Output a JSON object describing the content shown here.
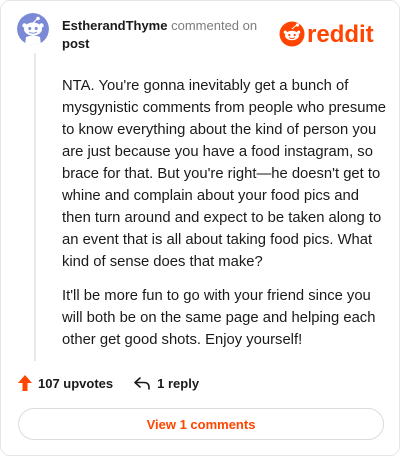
{
  "header": {
    "username": "EstherandThyme",
    "action_text": "commented on",
    "post_link": "post",
    "logo_text": "reddit"
  },
  "comment": {
    "paragraphs": [
      "NTA. You're gonna inevitably get a bunch of mysgynistic comments from people who presume to know everything about the kind of person you are just because you have a food instagram, so brace for that. But you're right—he doesn't get to whine and complain about your food pics and then turn around and expect to be taken along to an event that is all about taking food pics. What kind of sense does that make?",
      "It'll be more fun to go with your friend since you will both be on the same page and helping each other get good shots. Enjoy yourself!"
    ]
  },
  "actions": {
    "upvotes": "107 upvotes",
    "replies": "1 reply"
  },
  "footer": {
    "view_comments_label": "View 1 comments"
  },
  "colors": {
    "brand": "#ff4500",
    "avatar_bg": "#7a8ad6"
  }
}
